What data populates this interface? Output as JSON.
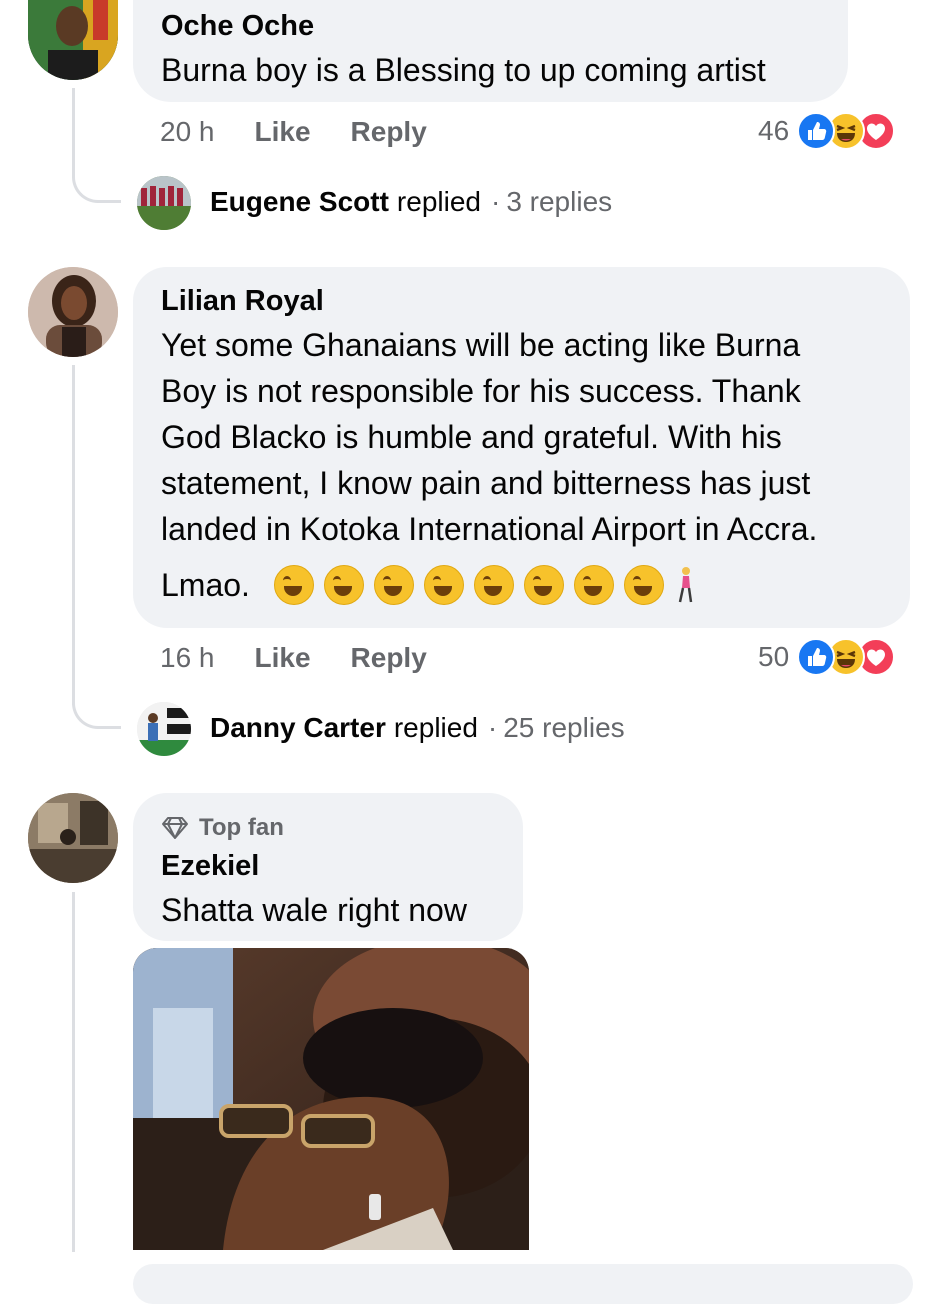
{
  "comments": [
    {
      "author": "Oche Oche",
      "text": "Burna boy is a Blessing to up coming artist",
      "time": "20 h",
      "like_label": "Like",
      "reply_label": "Reply",
      "reaction_count": "46",
      "reactions": [
        "like-icon",
        "haha-icon",
        "love-icon"
      ],
      "replies_preview": {
        "name": "Eugene Scott",
        "verb": "replied",
        "separator": "·",
        "count": "3 replies"
      }
    },
    {
      "author": "Lilian Royal",
      "text_lines": [
        "Yet some Ghanaians will be acting like Burna",
        "Boy is not responsible for his success.  Thank",
        "God Blacko is humble and grateful.  With his",
        "statement, I know pain and bitterness has just",
        "landed in Kotoka International Airport in Accra."
      ],
      "text_last": "Lmao.",
      "emoji": [
        "rofl-emoji",
        "rofl-emoji",
        "rofl-emoji",
        "rofl-emoji",
        "rofl-emoji",
        "rofl-emoji",
        "rofl-emoji",
        "rofl-emoji",
        "woman-walking-emoji"
      ],
      "time": "16 h",
      "like_label": "Like",
      "reply_label": "Reply",
      "reaction_count": "50",
      "reactions": [
        "like-icon",
        "haha-icon",
        "love-icon"
      ],
      "replies_preview": {
        "name": "Danny Carter",
        "verb": "replied",
        "separator": "·",
        "count": "25 replies"
      }
    },
    {
      "badge": "Top fan",
      "badge_icon": "diamond-icon",
      "author": "Ezekiel",
      "text": "Shatta wale right now",
      "attachment": "photo"
    }
  ],
  "colors": {
    "like": "#1877f2",
    "haha": "#f7c22b",
    "love": "#f33e58",
    "bubble": "#f0f2f5",
    "meta": "#65676b"
  }
}
